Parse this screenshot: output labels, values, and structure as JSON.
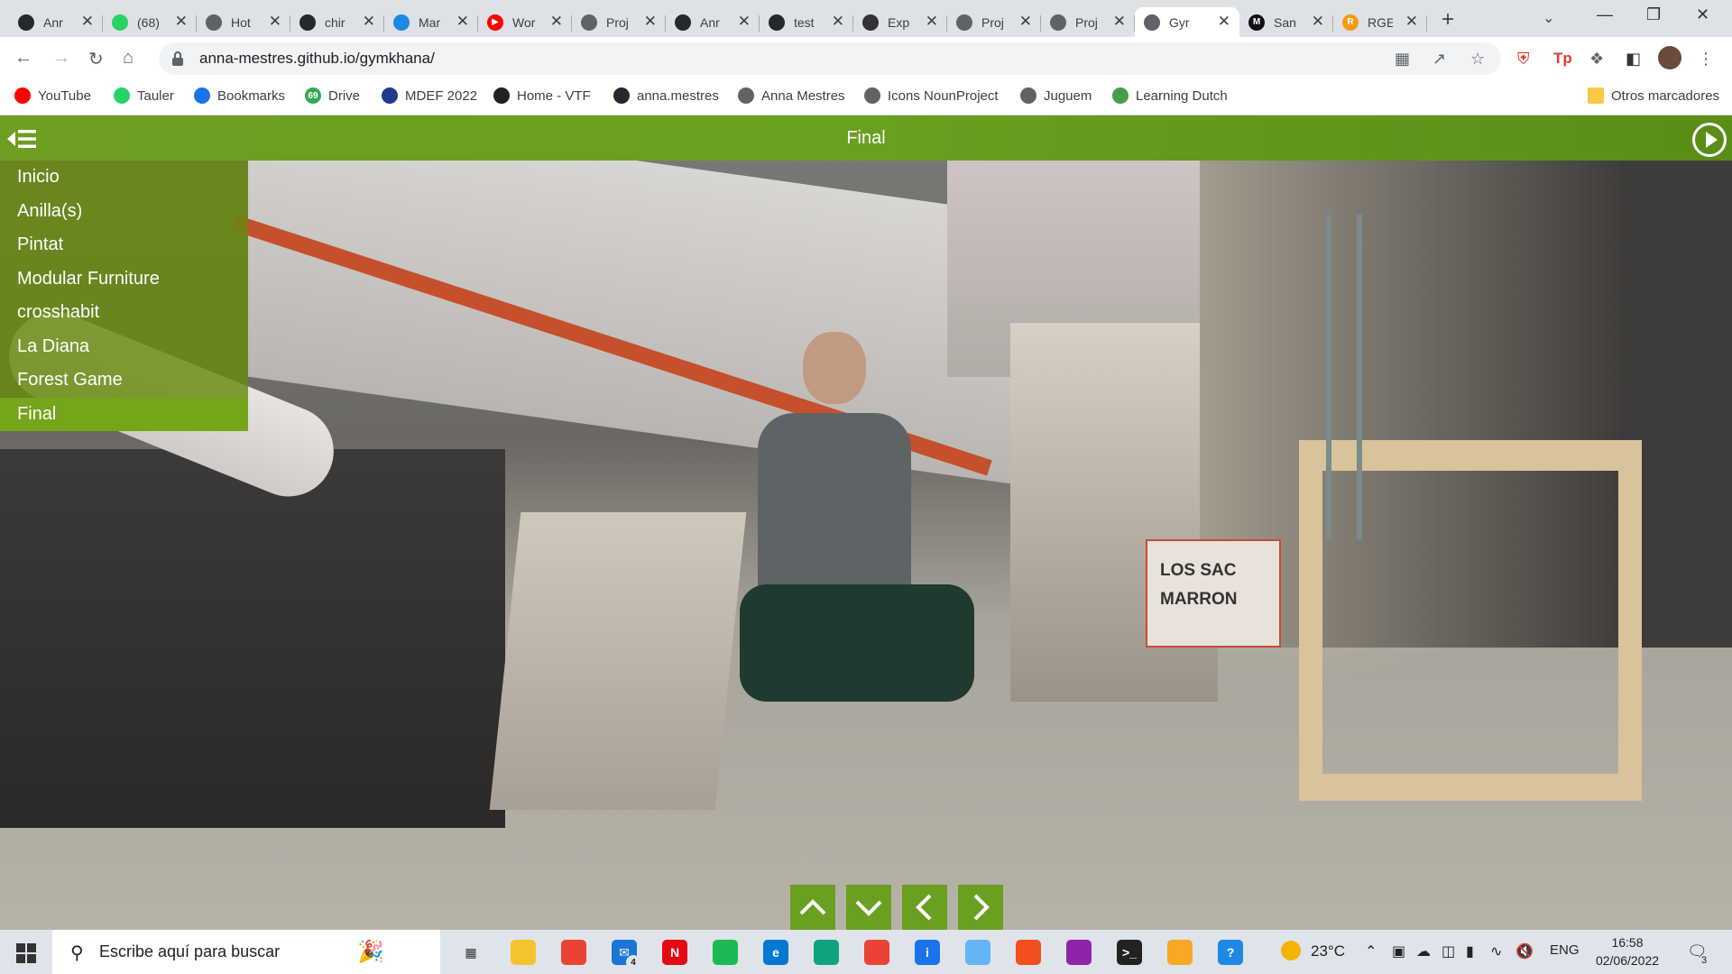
{
  "browser": {
    "tabs": [
      {
        "title": "Anr",
        "icon": "github-icon"
      },
      {
        "title": "(68)",
        "icon": "whatsapp-icon",
        "badge": "68"
      },
      {
        "title": "Hot",
        "icon": "globe-icon"
      },
      {
        "title": "chir",
        "icon": "github-icon"
      },
      {
        "title": "Mar",
        "icon": "drop-icon"
      },
      {
        "title": "Wor",
        "icon": "youtube-icon"
      },
      {
        "title": "Proj",
        "icon": "globe-icon"
      },
      {
        "title": "Anr",
        "icon": "github-icon"
      },
      {
        "title": "test",
        "icon": "github-icon"
      },
      {
        "title": "Exp",
        "icon": "linux-icon"
      },
      {
        "title": "Proj",
        "icon": "globe-icon"
      },
      {
        "title": "Proj",
        "icon": "globe-icon"
      },
      {
        "title": "Gyr",
        "icon": "globe-icon",
        "active": true
      },
      {
        "title": "San",
        "icon": "m-icon"
      },
      {
        "title": "RGE",
        "icon": "r-icon"
      }
    ],
    "url": "anna-mestres.github.io/gymkhana/",
    "bookmarks": [
      {
        "label": "YouTube",
        "icon": "youtube-icon"
      },
      {
        "label": "Tauler",
        "icon": "whatsapp-icon"
      },
      {
        "label": "Bookmarks",
        "icon": "star-icon"
      },
      {
        "label": "Drive",
        "icon": "drive-icon",
        "badge": "69"
      },
      {
        "label": "MDEF 2022",
        "icon": "mdef-icon"
      },
      {
        "label": "Home - VTF",
        "icon": "vtf-icon"
      },
      {
        "label": "anna.mestres",
        "icon": "github-icon"
      },
      {
        "label": "Anna Mestres",
        "icon": "globe-icon"
      },
      {
        "label": "Icons NounProject",
        "icon": "globe-icon"
      },
      {
        "label": "Juguem",
        "icon": "globe-icon"
      },
      {
        "label": "Learning Dutch",
        "icon": "dutch-icon"
      }
    ],
    "other_bookmarks": "Otros marcadores"
  },
  "tour": {
    "title": "Final",
    "scenes": [
      "Inicio",
      "Anilla(s)",
      "Pintat",
      "Modular Furniture",
      "crosshabit",
      "La Diana",
      "Forest Game",
      "Final"
    ],
    "current_scene": "Final",
    "photo_sign": [
      "LOS SAC",
      "MARRON"
    ]
  },
  "taskbar": {
    "search_placeholder": "Escribe aquí para buscar",
    "weather": "23°C",
    "language": "ENG",
    "time": "16:58",
    "date": "02/06/2022",
    "notifications": "3",
    "mail_badge": "4",
    "apps": [
      "task-view-icon",
      "file-explorer-icon",
      "chrome-icon",
      "mail-icon",
      "netflix-icon",
      "spotify-icon",
      "edge-icon",
      "openai-icon",
      "chrome-profile-icon",
      "app-icon",
      "notes-icon",
      "figma-icon",
      "winrar-icon",
      "terminal-icon",
      "files-icon",
      "help-icon"
    ]
  },
  "colors": {
    "tour_green": "#6aa020",
    "menu_green": "#678a0d",
    "current_scene": "#74a51a"
  }
}
